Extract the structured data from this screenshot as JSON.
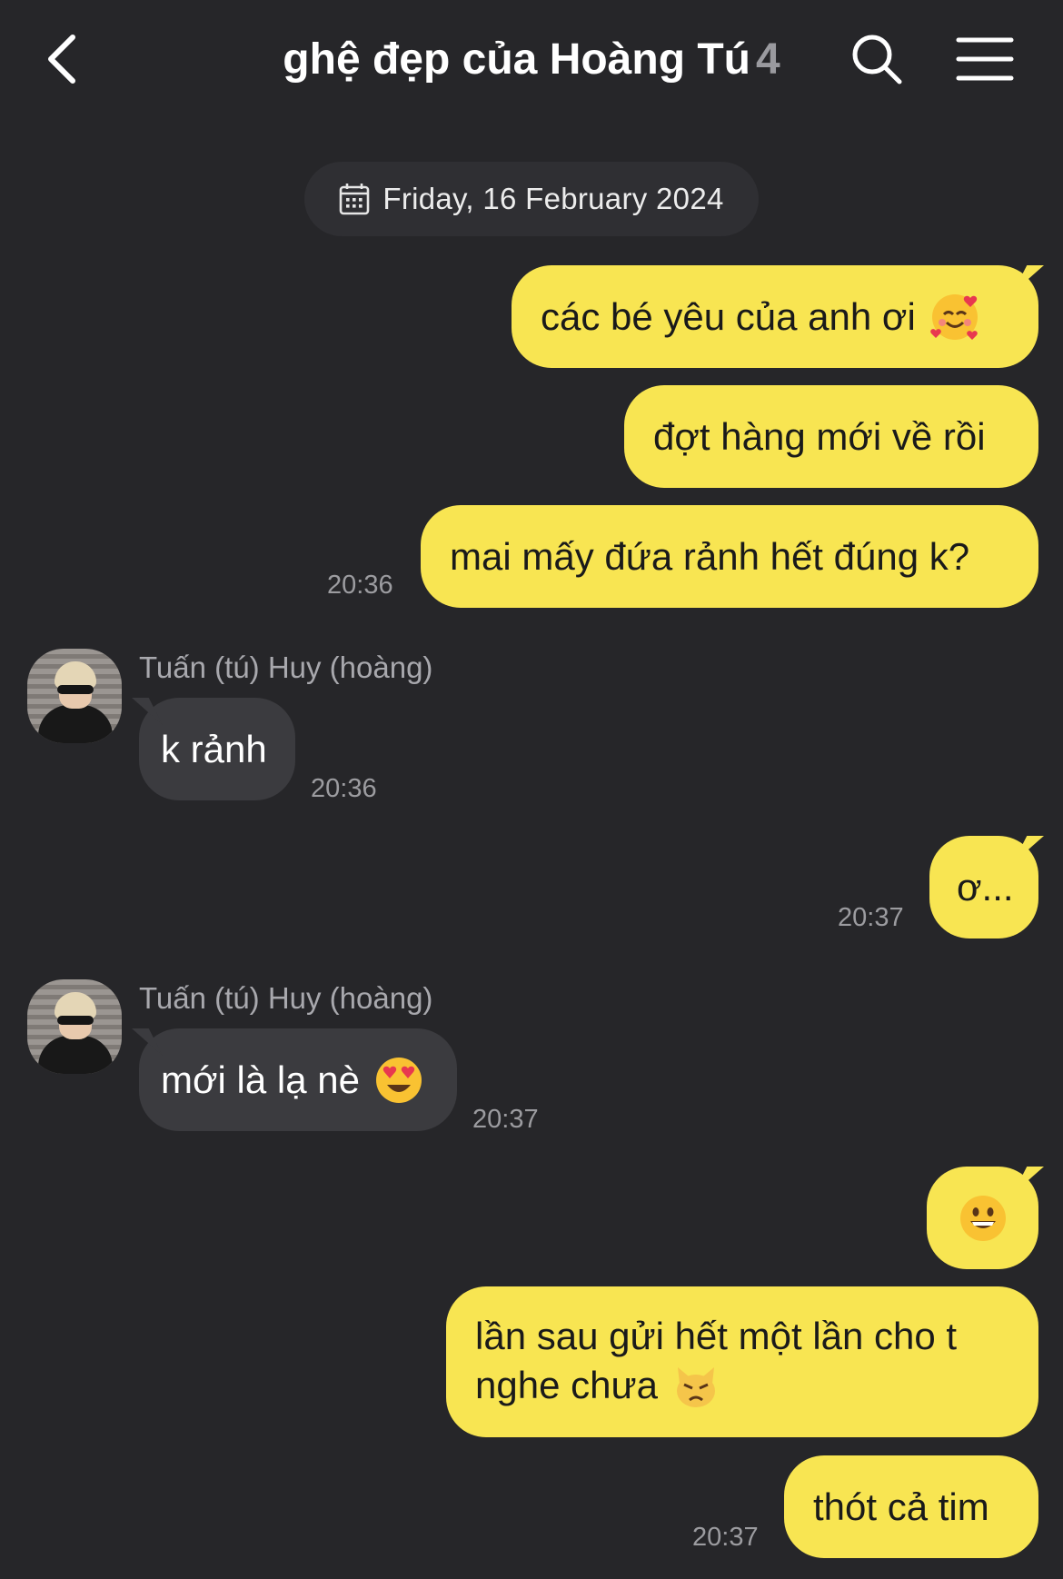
{
  "header": {
    "title": "ghệ đẹp của Hoàng Tú",
    "member_count": "4",
    "back_icon": "chevron-left-icon",
    "search_icon": "search-icon",
    "menu_icon": "hamburger-menu-icon"
  },
  "date_separator": {
    "icon": "calendar-icon",
    "text": "Friday, 16 February 2024"
  },
  "colors": {
    "background": "#262629",
    "own_bubble": "#f8e552",
    "other_bubble": "#3b3b3f",
    "timestamp": "#9c9ca0"
  },
  "messages": [
    {
      "from": "me",
      "text": "các bé yêu của anh ơi",
      "emoji": "smiling-face-with-hearts"
    },
    {
      "from": "me",
      "text": "đợt hàng mới về rồi"
    },
    {
      "from": "me",
      "text": "mai mấy đứa rảnh hết đúng k?",
      "time": "20:36"
    },
    {
      "from": "other",
      "sender": "Tuấn (tú) Huy (hoàng)",
      "text": "k rảnh",
      "time": "20:36"
    },
    {
      "from": "me",
      "text": "ơ...",
      "time": "20:37"
    },
    {
      "from": "other",
      "sender": "Tuấn (tú) Huy (hoàng)",
      "text": "mới là lạ nè",
      "emoji": "heart-eyes",
      "time": "20:37"
    },
    {
      "from": "me",
      "text": "",
      "emoji": "grinning-face"
    },
    {
      "from": "me",
      "text_line1": "lần sau gửi hết một lần cho t",
      "text_line2": "nghe chưa",
      "emoji": "pouting-cat"
    },
    {
      "from": "me",
      "text": "thót cả tim",
      "time": "20:37"
    }
  ]
}
